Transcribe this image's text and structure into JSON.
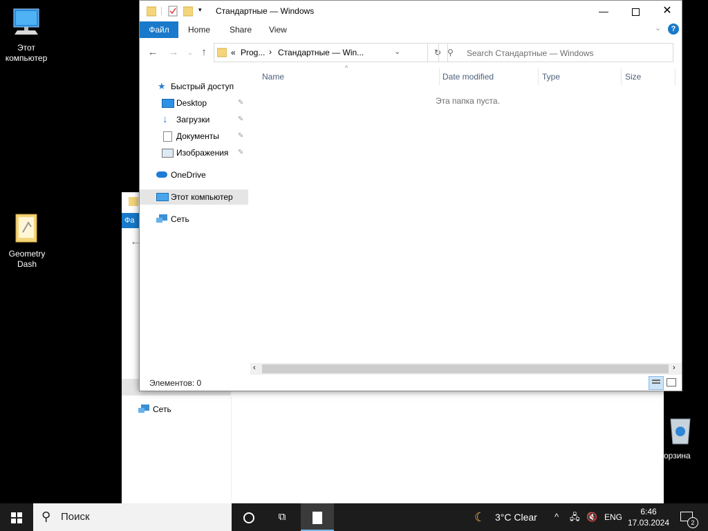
{
  "desktop": {
    "icons": [
      {
        "label": "Этот компьютер"
      },
      {
        "label": "Geometry Dash"
      },
      {
        "label": "орзина"
      }
    ]
  },
  "background_window": {
    "file_tab": "Фа",
    "nav_network": "Сеть"
  },
  "window": {
    "title": "Стандартные — Windows",
    "ribbon": {
      "file": "Файл",
      "home": "Home",
      "share": "Share",
      "view": "View"
    },
    "address": {
      "overflow": "«",
      "crumb1": "Prog...",
      "crumb2": "Стандартные — Win..."
    },
    "search_placeholder": "Search Стандартные — Windows",
    "nav": {
      "quick_access": "Быстрый доступ",
      "desktop": "Desktop",
      "downloads": "Загрузки",
      "documents": "Документы",
      "pictures": "Изображения",
      "onedrive": "OneDrive",
      "this_pc": "Этот компьютер",
      "network": "Сеть"
    },
    "columns": {
      "name": "Name",
      "date": "Date modified",
      "type": "Type",
      "size": "Size"
    },
    "empty_message": "Эта папка пуста.",
    "status": "Элементов: 0"
  },
  "taskbar": {
    "search_label": "Поиск",
    "weather": "3°C  Clear",
    "language": "ENG",
    "time": "6:46",
    "date": "17.03.2024",
    "notifications": "2"
  },
  "colors": {
    "accent": "#1979ca",
    "taskbar": "#1c1c1c",
    "selection": "#e5e5e5"
  }
}
